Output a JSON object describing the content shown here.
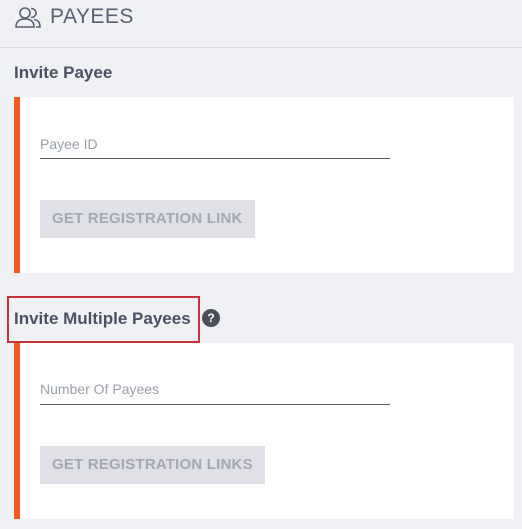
{
  "header": {
    "title": "PAYEES",
    "icon": "users-icon"
  },
  "invite_payee": {
    "title": "Invite Payee",
    "field_placeholder": "Payee ID",
    "button_label": "GET REGISTRATION LINK"
  },
  "invite_multiple": {
    "title": "Invite Multiple Payees",
    "help_icon": "?",
    "field_placeholder": "Number Of Payees",
    "button_label": "GET REGISTRATION LINKS"
  },
  "colors": {
    "accent": "#f05a1e",
    "highlight": "#c9313a"
  }
}
